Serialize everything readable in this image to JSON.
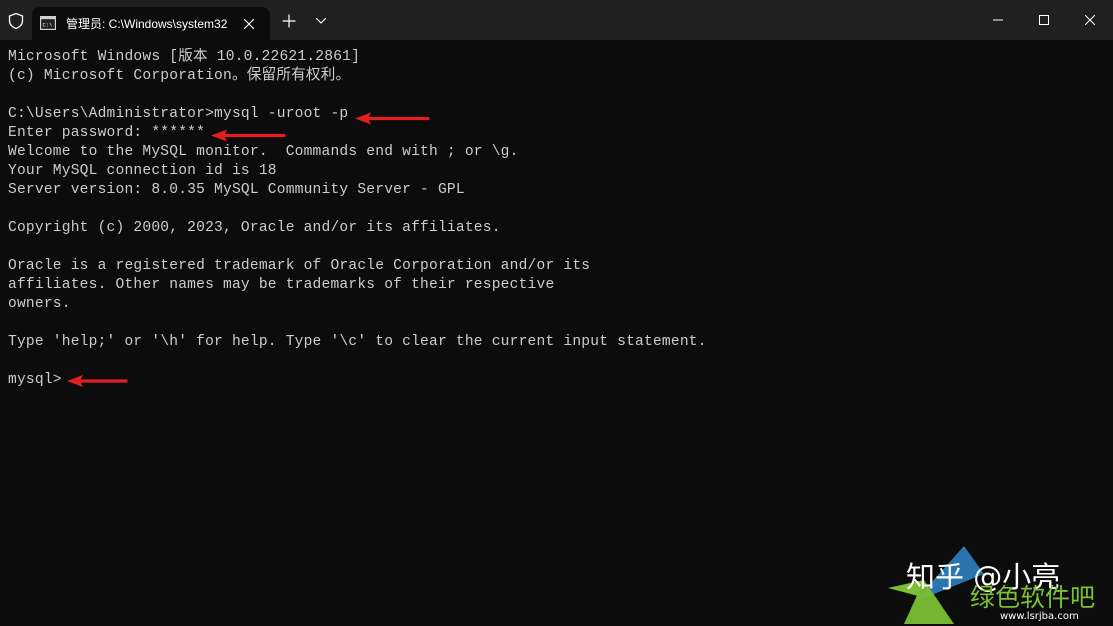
{
  "titlebar": {
    "tab_title": "管理员: C:\\Windows\\system32"
  },
  "terminal": {
    "lines": [
      "Microsoft Windows [版本 10.0.22621.2861]",
      "(c) Microsoft Corporation。保留所有权利。",
      "",
      "C:\\Users\\Administrator>mysql -uroot -p",
      "Enter password: ******",
      "Welcome to the MySQL monitor.  Commands end with ; or \\g.",
      "Your MySQL connection id is 18",
      "Server version: 8.0.35 MySQL Community Server - GPL",
      "",
      "Copyright (c) 2000, 2023, Oracle and/or its affiliates.",
      "",
      "Oracle is a registered trademark of Oracle Corporation and/or its",
      "affiliates. Other names may be trademarks of their respective",
      "owners.",
      "",
      "Type 'help;' or '\\h' for help. Type '\\c' to clear the current input statement.",
      "",
      "mysql>"
    ]
  },
  "watermark": {
    "zhihu": "知乎 @小亮",
    "site_name": "绿色软件吧",
    "site_url": "www.lsrjba.com"
  },
  "colors": {
    "terminal_bg": "#0c0c0c",
    "titlebar_bg": "#202020",
    "terminal_text": "#cccccc",
    "annotation_arrow": "#e0201f",
    "watermark_green": "#7cbf34",
    "watermark_blue": "#2f7fc1"
  },
  "icons": {
    "shield": "shield-icon",
    "tab": "terminal-icon",
    "close_tab": "close-icon",
    "new_tab": "plus-icon",
    "dropdown": "chevron-down-icon",
    "minimize": "minimize-icon",
    "maximize": "maximize-icon",
    "close_window": "close-icon"
  }
}
